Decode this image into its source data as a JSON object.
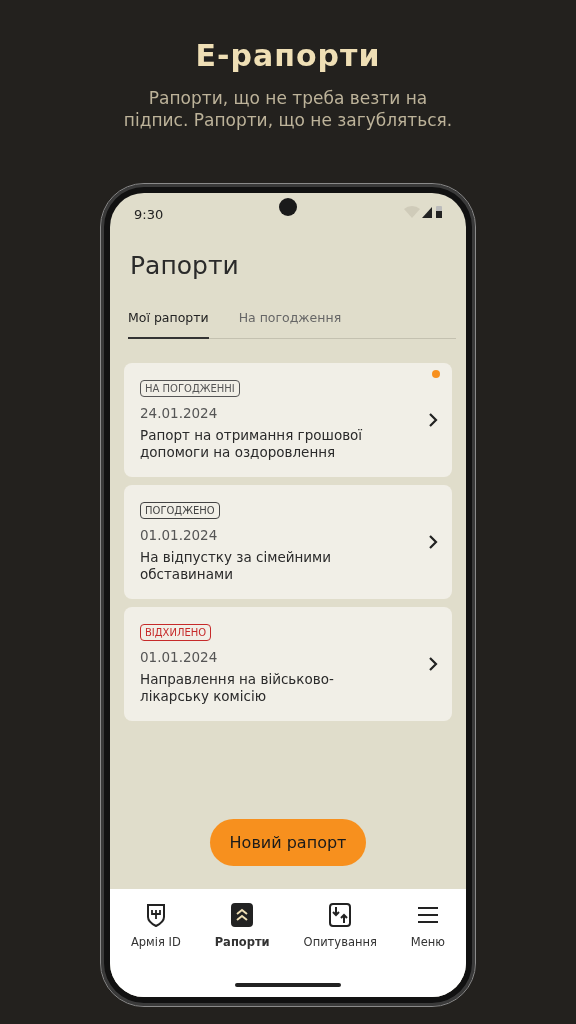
{
  "promo": {
    "title": "E-рапорти",
    "subtitle": "Рапорти, що не треба везти на підпис. Рапорти, що не загубляться."
  },
  "status_bar": {
    "time": "9:30"
  },
  "screen_title": "Рапорти",
  "tabs": [
    {
      "label": "Мої рапорти",
      "selected": true
    },
    {
      "label": "На погодження",
      "selected": false
    }
  ],
  "reports": [
    {
      "status": {
        "label": "НА ПОГОДЖЕННІ",
        "kind": "pending"
      },
      "date": "24.01.2024",
      "title": "Рапорт на отримання грошової допомоги на оздоровлення",
      "unread": true
    },
    {
      "status": {
        "label": "ПОГОДЖЕНО",
        "kind": "approved"
      },
      "date": "01.01.2024",
      "title": "На відпустку за сімейними обставинами",
      "unread": false
    },
    {
      "status": {
        "label": "ВІДХИЛЕНО",
        "kind": "rejected"
      },
      "date": "01.01.2024",
      "title": "Направлення на військово-лікарську комісію",
      "unread": false
    }
  ],
  "new_button": "Новий рапорт",
  "nav": [
    {
      "label": "Армія ID",
      "kind": "shield",
      "selected": false
    },
    {
      "label": "Рапорти",
      "kind": "reports",
      "selected": true
    },
    {
      "label": "Опитування",
      "kind": "survey",
      "selected": false
    },
    {
      "label": "Меню",
      "kind": "menu",
      "selected": false
    }
  ]
}
